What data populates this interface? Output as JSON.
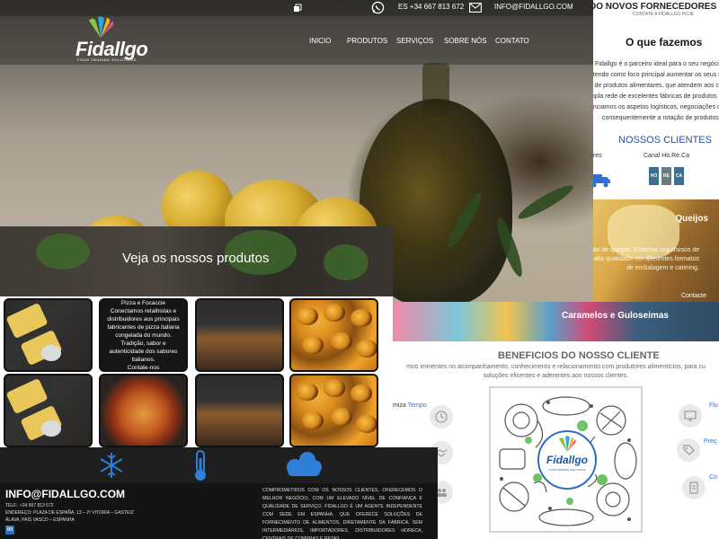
{
  "hero": {
    "topbar": {
      "whatsapp_icon": "whatsapp-icon",
      "phone": "ES +34 667 813 672",
      "mail_icon": "mail-icon",
      "email": "INFO@FIDALLGO.COM"
    },
    "logo": {
      "name": "Fidallgo",
      "tagline": "FOOD TRADING SOLUTIONS"
    },
    "nav": [
      "INICIO",
      "PRODUTOS",
      "SERVIÇOS",
      "SOBRE NÓS",
      "CONTATO"
    ]
  },
  "products": {
    "title": "Veja os nossos produtos",
    "info_card": {
      "heading": "Pizza e Focaccie",
      "body": "Conectamos retalhistas e distribuidores aos principais fabricantes de pizza italiana congelada do mundo. Tradição, sabor e autenticidade dos sabores Italianos.",
      "cta": "Contate-nos"
    }
  },
  "icon_strip": [
    "snowflake-icon",
    "thermometer-icon",
    "cloud-icon"
  ],
  "footer": {
    "email": "INFO@FIDALLGO.COM",
    "tel": "TELF.: +34 667 813 672",
    "address1": "ENDEREÇO: PLAZA DE ESPAÑA, 13 – 2ª VITORIA – GASTEIZ",
    "address2": "ÁLAVA, PAÍS VASCO – ESPANHA",
    "about": "COMPROMETIDOS COM OS NOSSOS CLIENTES, OFERECEMOS O MELHOR NEGÓCIO, COM UM ELEVADO NÍVEL DE CONFIANÇA E QUALIDADE DE SERVIÇO. FIDALLGO É UM AGENTE INDEPENDENTE COM SEDE EM ESPANHA, QUE OFERECE SOLUÇÕES DE FORNECIMENTO DE ALIMENTOS, DIRETAMENTE DA FÁBRICA, SEM INTERMEDIÁRIOS, IMPORTADORES, DISTRIBUIDORES HORECA, CENTRAIS DE COMPRAS E RETAIL."
  },
  "right_page": {
    "header": "DO NOVOS FORNECEDORES PARA",
    "subheader": "CONTATE A FIDALLGO HOJE",
    "section_title": "O que fazemos",
    "paragraph": [
      "Fidallgo é o parceiro ideal para o seu negócio.",
      ", tendo como foco principal aumentar os seus r",
      "s de produtos alimentares, que atendem aos c",
      "mpla rede de excelentes fábricas de produtos ali",
      "enciamos os aspetos logísticos, negociações co",
      "consequentemente a rotação de produtos."
    ],
    "clients_title": "NOSSOS CLIENTES",
    "client_left": "ores",
    "client_canal": "Canal Ho.Re.Ca",
    "badges": [
      "HO",
      "RE",
      "CA"
    ],
    "queijos": {
      "title": "Queijos",
      "text": [
        "ção de queijos. Estamos orgulhosos de",
        "alta qualidade em diferentes formatos",
        "de embalagem e catering."
      ],
      "cta": "Contacte"
    },
    "caramelos": {
      "title": "Caramelos e Guloseimas"
    },
    "benefits": {
      "title": "BENEFICIOS DO NOSSO CLIENTE",
      "lines": [
        "mos iminentes no acompanhamento, conhecimento e relacionamento com produtores alimentícios, para cu",
        "soluções eficentes e aderentes aos nossos clientes."
      ],
      "side_label": "miza",
      "side_link": "Tempo",
      "right_labels": [
        "Flu",
        "Preç",
        "Co"
      ]
    },
    "seal": {
      "name": "Fidallgo",
      "tagline": "FOOD TRADING SOLUTIONS"
    }
  },
  "colors": {
    "accent_blue": "#2d4fa0",
    "link_blue": "#3a6fc4",
    "footer_bg": "#141414",
    "strip_icon_blue": "#2f7fd8"
  }
}
